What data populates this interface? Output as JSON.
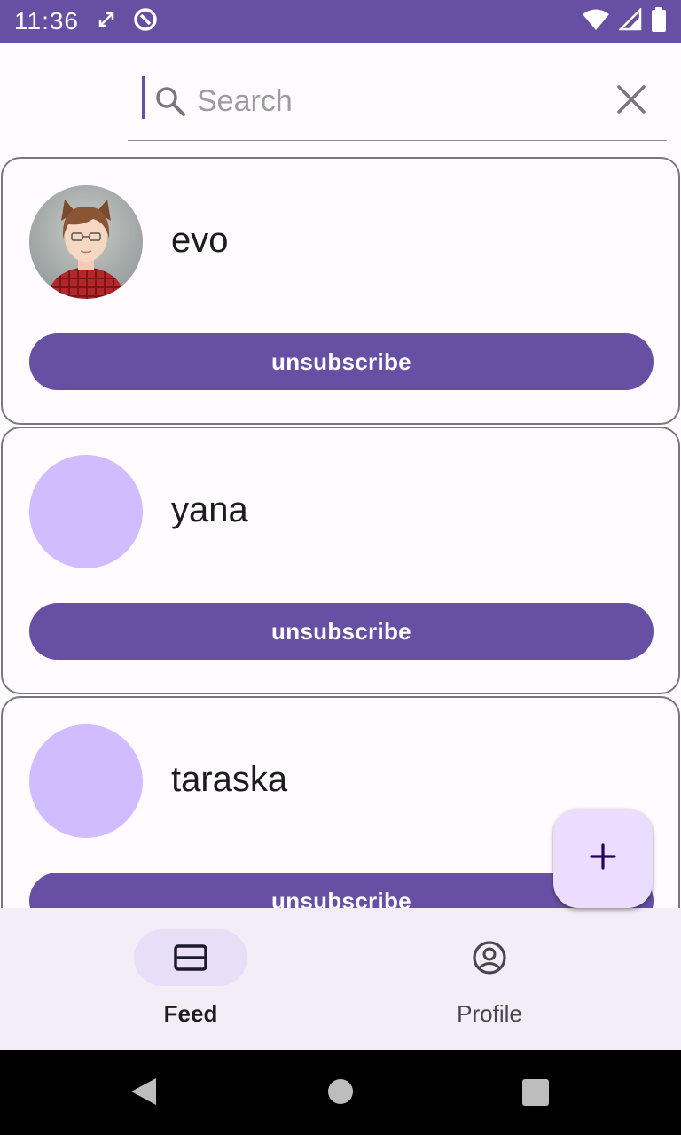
{
  "status_bar": {
    "time": "11:36"
  },
  "search": {
    "placeholder": "Search",
    "value": ""
  },
  "subscriptions": [
    {
      "username": "evo",
      "action_label": "unsubscribe",
      "has_photo": true
    },
    {
      "username": "yana",
      "action_label": "unsubscribe",
      "has_photo": false
    },
    {
      "username": "taraska",
      "action_label": "unsubscribe",
      "has_photo": false
    }
  ],
  "bottom_nav": {
    "items": [
      {
        "label": "Feed",
        "icon": "feed-icon",
        "selected": true
      },
      {
        "label": "Profile",
        "icon": "profile-icon",
        "selected": false
      }
    ]
  },
  "colors": {
    "primary": "#6750a4",
    "avatar_placeholder": "#d0bcff",
    "fab_background": "#eaddff",
    "nav_background": "#f3edf7",
    "nav_indicator": "#e8def8"
  },
  "icons": {
    "fab": "plus-icon",
    "clear": "close-icon",
    "search": "search-icon"
  }
}
